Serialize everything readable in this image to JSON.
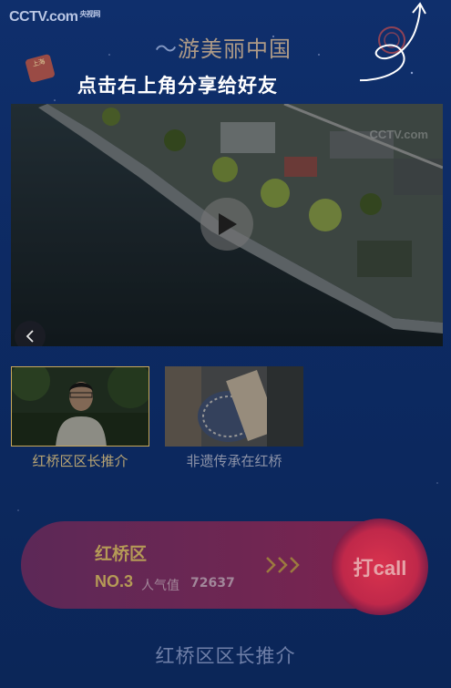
{
  "header": {
    "logo_text": "CCTV",
    "logo_suffix": ".com",
    "logo_small": "央视网",
    "badge_text": "上海",
    "campaign_parts": [
      "游",
      "美",
      "丽",
      "中",
      "国"
    ],
    "share_hint": "点击右上角分享给好友"
  },
  "video": {
    "watermark": "CCTV.com",
    "play_icon": "play-icon",
    "back_icon": "chevron-left-icon"
  },
  "thumbnails": [
    {
      "label": "红桥区区长推介",
      "selected": true
    },
    {
      "label": "非遗传承在红桥",
      "selected": false
    }
  ],
  "rank_card": {
    "district": "红桥区",
    "rank": "NO.3",
    "popularity_label": "人气值",
    "popularity_value": "72637",
    "chevrons": "»»",
    "call_label": "打call"
  },
  "section_title": "红桥区区长推介",
  "colors": {
    "accent_gold": "#b59a56",
    "call_red": "#d9334e",
    "background": "#0f2f6c"
  }
}
